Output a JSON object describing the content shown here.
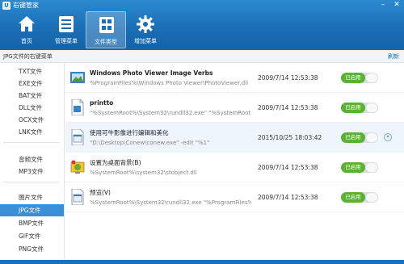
{
  "app": {
    "title": "右键管家",
    "logo_char": "U"
  },
  "window": {
    "min": "–",
    "close": "✕"
  },
  "toolbar": [
    {
      "label": "首页",
      "icon": "home-icon"
    },
    {
      "label": "管理菜单",
      "icon": "menu-list-icon"
    },
    {
      "label": "文件类型",
      "icon": "file-type-icon",
      "active": true
    },
    {
      "label": "增加菜单",
      "icon": "gear-icon"
    }
  ],
  "strip": {
    "title": "JPG文件的右键菜单",
    "refresh": "刷新"
  },
  "sidebar": {
    "items": [
      {
        "label": "TXT文件"
      },
      {
        "label": "EXE文件"
      },
      {
        "label": "BAT文件"
      },
      {
        "label": "DLL文件"
      },
      {
        "label": "OCX文件"
      },
      {
        "label": "LNK文件"
      },
      {
        "label": "音频文件"
      },
      {
        "label": "MP3文件"
      },
      {
        "label": "图片文件"
      },
      {
        "label": "JPG文件",
        "selected": true
      },
      {
        "label": "BMP文件"
      },
      {
        "label": "GIF文件"
      },
      {
        "label": "PNG文件"
      }
    ]
  },
  "rows": [
    {
      "name": "Windows Photo Viewer Image Verbs",
      "path": "%ProgramFiles%\\Windows Photo Viewer\\PhotoViewer.dll",
      "date": "2009/7/14 12:53:38",
      "status": "已启用",
      "icon": "photo-viewer-icon"
    },
    {
      "name": "printto",
      "path": "\"%SystemRoot%\\System32\\rundll32.exe\" \"%SystemRoot...",
      "date": "2009/7/14 12:53:38",
      "status": "已启用",
      "icon": "document-icon"
    },
    {
      "name": "使用可牛影像进行编辑和美化",
      "path": "\"D:\\Desktop\\Conew\\conew.exe\" -edit \"%1\"",
      "date": "2015/10/25 18:03:42",
      "status": "已启用",
      "icon": "exe-icon",
      "expand": "▾"
    },
    {
      "name": "设置为桌面背景(B)",
      "path": "%SystemRoot%\\system32\\stobject.dll",
      "date": "2009/7/14 12:53:38",
      "status": "已启用",
      "icon": "wallpaper-icon"
    },
    {
      "name": "预览(V)",
      "path": "%SystemRoot%\\System32\\rundll32.exe \"%ProgramFiles%...",
      "date": "2009/7/14 12:53:38",
      "status": "已启用",
      "icon": "exe-icon"
    }
  ],
  "colors": {
    "accent": "#1a6fb6",
    "enabled": "#5cb135",
    "selected": "#3b8fd6"
  }
}
